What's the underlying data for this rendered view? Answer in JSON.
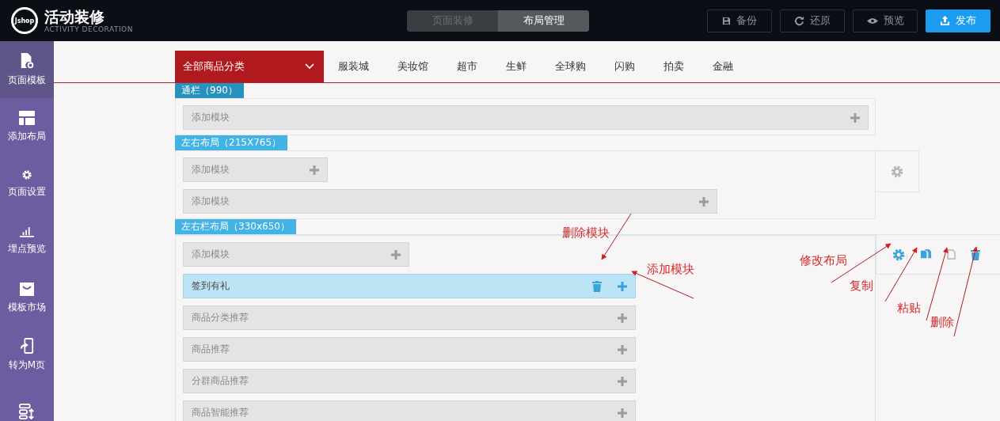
{
  "header": {
    "logo_text": "Jshop",
    "title": "活动装修",
    "subtitle": "ACTIVITY DECORATION",
    "mode_tabs": [
      {
        "label": "页面装修",
        "selected": false
      },
      {
        "label": "布局管理",
        "selected": true
      }
    ],
    "actions": [
      {
        "label": "备份",
        "kind": "backup"
      },
      {
        "label": "还原",
        "kind": "restore"
      },
      {
        "label": "预览",
        "kind": "preview"
      },
      {
        "label": "发布",
        "kind": "publish"
      }
    ]
  },
  "sidebar": {
    "items": [
      {
        "label": "页面模板",
        "kind": "template",
        "selected": true
      },
      {
        "label": "添加布局",
        "kind": "layout",
        "selected": false
      },
      {
        "label": "页面设置",
        "kind": "settings",
        "selected": false
      },
      {
        "label": "埋点预览",
        "kind": "tracking",
        "selected": false
      },
      {
        "label": "模板市场",
        "kind": "market",
        "selected": false
      },
      {
        "label": "转为M页",
        "kind": "mobile",
        "selected": false
      },
      {
        "kind": "sort",
        "selected": false
      }
    ]
  },
  "nav": {
    "dropdown": "全部商品分类",
    "links": [
      "服装城",
      "美妆馆",
      "超市",
      "生鲜",
      "全球购",
      "闪购",
      "拍卖",
      "金融"
    ]
  },
  "sections": [
    {
      "kind": "banner",
      "tag": "通栏（990）",
      "rows": [
        {
          "label": "添加模块",
          "selected": false
        }
      ]
    },
    {
      "kind": "split",
      "tag": "左右布局（215X765）",
      "rows": [
        {
          "label": "添加模块",
          "selected": false
        },
        {
          "label": "添加模块",
          "selected": false
        }
      ],
      "tools": [
        {
          "kind": "settings",
          "disabled": true
        }
      ]
    },
    {
      "kind": "columns",
      "tag": "左右栏布局（330x650）",
      "rows": [
        {
          "label": "添加模块",
          "selected": false
        },
        {
          "label": "签到有礼",
          "selected": true
        },
        {
          "label": "商品分类推荐",
          "selected": false
        },
        {
          "label": "商品推荐",
          "selected": false
        },
        {
          "label": "分群商品推荐",
          "selected": false
        },
        {
          "label": "商品智能推荐",
          "selected": false
        }
      ],
      "tools": [
        {
          "kind": "settings",
          "disabled": false
        },
        {
          "kind": "copy",
          "disabled": false
        },
        {
          "kind": "paste",
          "disabled": true
        },
        {
          "kind": "delete",
          "disabled": false
        }
      ]
    }
  ],
  "annotations": [
    "删除模块",
    "添加模块",
    "修改布局",
    "复制",
    "粘贴",
    "删除"
  ]
}
